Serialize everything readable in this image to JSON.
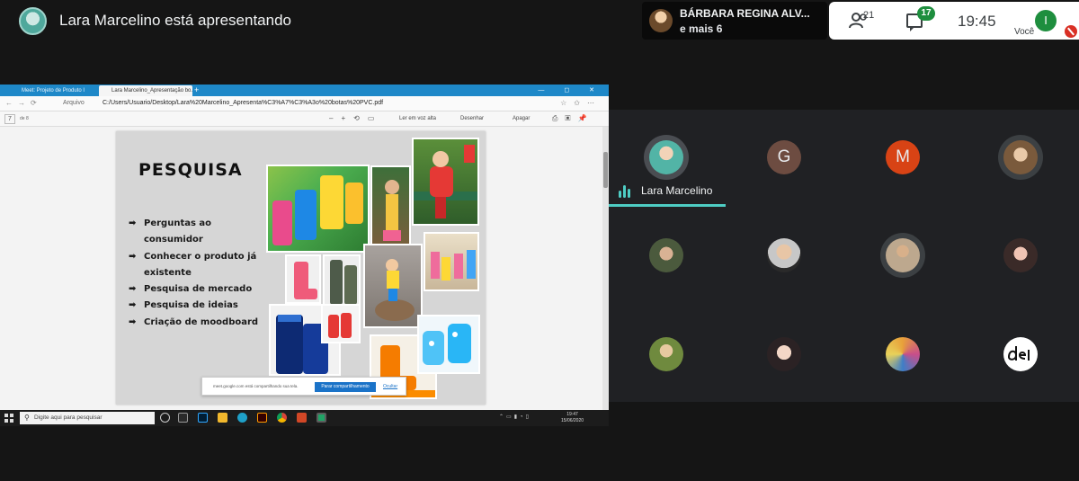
{
  "top_bar": {
    "presenter_title": "Lara Marcelino está apresentando",
    "others_name": "BÁRBARA REGINA ALV...",
    "others_more": "e mais 6",
    "people_count": "21",
    "chat_badge": "17",
    "clock": "19:45",
    "self_initial": "I",
    "self_label": "Você"
  },
  "shared_screen": {
    "tabs": [
      "Meet: Projeto de Produto I",
      "Lara Marcelino_Apresentação bo..."
    ],
    "tab_new": "+",
    "window_controls": "— ◻ ✕",
    "address_label": "Arquivo",
    "address_url": "C:/Users/Usuario/Desktop/Lara%20Marcelino_Apresenta%C3%A7%C3%A3o%20botas%20PVC.pdf",
    "pdf_page": "7",
    "pdf_page_of": "de 8",
    "pdf_read_aloud": "Ler em voz alta",
    "pdf_draw": "Desenhar",
    "pdf_erase": "Apagar",
    "slide": {
      "title": "PESQUISA",
      "bullets": [
        "Perguntas ao consumidor",
        "Conhecer o produto já existente",
        "Pesquisa de mercado",
        "Pesquisa de ideias",
        "Criação de moodboard"
      ]
    },
    "cookie_bar": {
      "text": "meet.google.com está compartilhando sua tela.",
      "stop_label": "Parar compartilhamento",
      "hide_label": "Ocultar"
    },
    "taskbar": {
      "search_placeholder": "Digite aqui para pesquisar",
      "time": "19:47",
      "date": "15/06/2020"
    }
  },
  "participants": {
    "speaker_name": "Lara Marcelino",
    "letters": [
      "G",
      "M"
    ]
  },
  "colors": {
    "accent_teal": "#4ecdc4",
    "meet_green": "#1e8e3e",
    "mic_off_red": "#d93025",
    "edge_blue": "#1e88c8"
  }
}
